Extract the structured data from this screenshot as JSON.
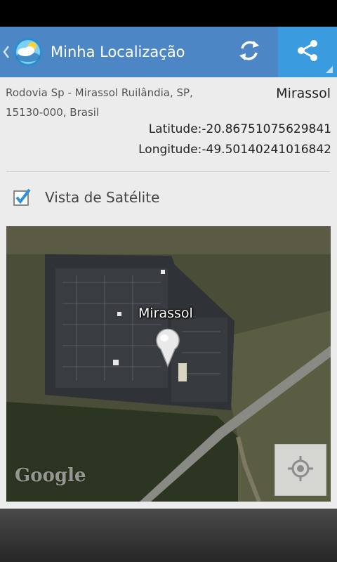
{
  "app": {
    "title": "Minha Localização"
  },
  "location": {
    "address_line1": "Rodovia Sp - Mirassol Ruilândia, SP,",
    "address_line2": "15130-000, Brasil",
    "city": "Mirassol",
    "latitude_label": "Latitude:",
    "latitude_value": "-20.86751075629841",
    "longitude_label": "Longitude:",
    "longitude_value": "-49.50140241016842"
  },
  "satellite_option": {
    "label": "Vista de Satélite",
    "checked": true
  },
  "map": {
    "marker_label": "Mirassol",
    "attribution": "Google"
  },
  "colors": {
    "action_bar": "#4d86c4",
    "share_button": "#3a9bde",
    "checkbox_accent": "#2f8fd8"
  },
  "icons": {
    "back": "chevron-left-icon",
    "app": "weather-globe-icon",
    "refresh": "refresh-icon",
    "share": "share-icon",
    "checkbox": "checkbox-checked-icon",
    "marker": "map-pin-icon",
    "locate": "my-location-icon"
  }
}
